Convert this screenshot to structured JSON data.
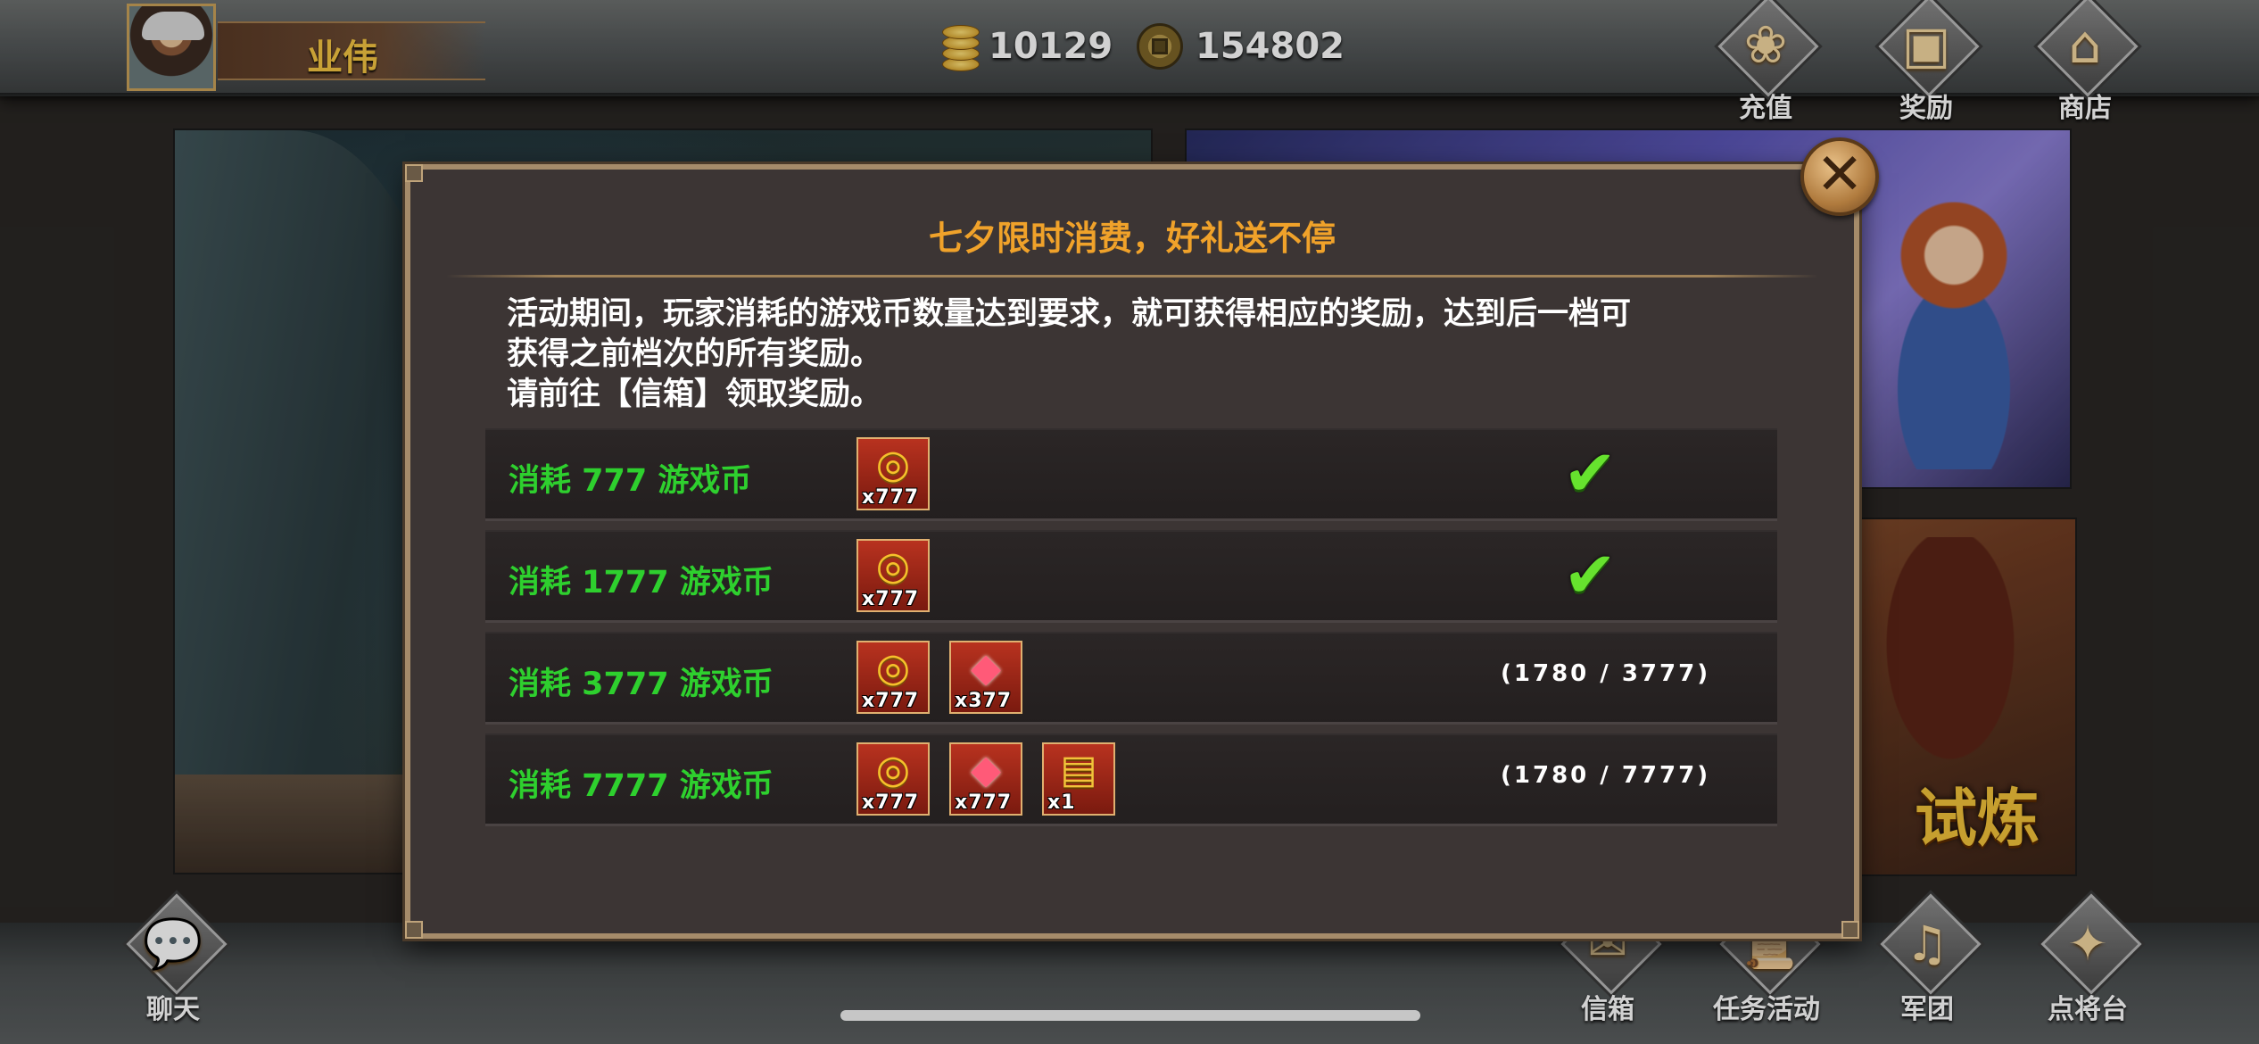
{
  "player": {
    "name": "业伟"
  },
  "currency": {
    "gold": "10129",
    "copper": "154802"
  },
  "top_menu": [
    {
      "label": "充值",
      "icon": "gift-basket-icon"
    },
    {
      "label": "奖励",
      "icon": "gift-box-icon"
    },
    {
      "label": "商店",
      "icon": "shop-pavilion-icon"
    }
  ],
  "bottom_menu": [
    {
      "label": "聊天",
      "icon": "chat-icon"
    },
    {
      "label": "信箱",
      "icon": "mail-icon"
    },
    {
      "label": "任务活动",
      "icon": "scroll-icon"
    },
    {
      "label": "军团",
      "icon": "horn-icon"
    },
    {
      "label": "点将台",
      "icon": "token-icon"
    }
  ],
  "banner": {
    "right_bottom_text": "试炼"
  },
  "dialog": {
    "title": "七夕限时消费，好礼送不停",
    "desc_line1": "活动期间，玩家消耗的游戏币数量达到要求，就可获得相应的奖励，达到后一档可",
    "desc_line2": "获得之前档次的所有奖励。",
    "desc_line3": "请前往【信箱】领取奖励。",
    "close_icon": "close-icon",
    "tiers": [
      {
        "label": "消耗 777 游戏币",
        "rewards": [
          {
            "icon": "gold-coins-icon",
            "qty": "x777"
          }
        ],
        "completed": true,
        "progress": ""
      },
      {
        "label": "消耗 1777 游戏币",
        "rewards": [
          {
            "icon": "gold-coins-icon",
            "qty": "x777"
          }
        ],
        "completed": true,
        "progress": ""
      },
      {
        "label": "消耗 3777 游戏币",
        "rewards": [
          {
            "icon": "gold-coins-icon",
            "qty": "x777"
          },
          {
            "icon": "red-gem-icon",
            "qty": "x377"
          }
        ],
        "completed": false,
        "progress": "(1780 / 3777)"
      },
      {
        "label": "消耗 7777 游戏币",
        "rewards": [
          {
            "icon": "gold-coins-icon",
            "qty": "x777"
          },
          {
            "icon": "red-gem-icon",
            "qty": "x777"
          },
          {
            "icon": "treasure-chest-icon",
            "qty": "x1"
          }
        ],
        "completed": false,
        "progress": "(1780 / 7777)"
      }
    ]
  },
  "colors": {
    "title_orange": "#f0a22a",
    "tier_green": "#2ed02e",
    "check_green": "#66e22e",
    "dialog_bg": "#3c3534",
    "dialog_border": "#a58b6a",
    "reward_red": "#b8321f"
  }
}
